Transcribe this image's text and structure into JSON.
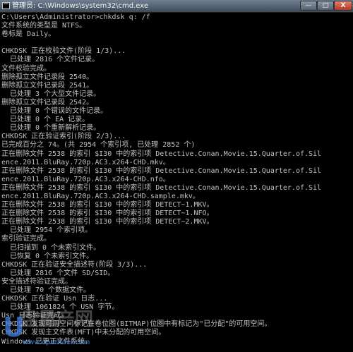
{
  "window": {
    "title": "管理员: C:\\Windows\\system32\\cmd.exe",
    "controls": {
      "minimize": "—",
      "maximize": "□",
      "close": "X"
    }
  },
  "console": {
    "lines": [
      "C:\\Users\\Administrator>chkdsk q: /f",
      "文件系统的类型是 NTFS。",
      "卷标是 Daily。",
      "",
      "CHKDSK 正在校验文件(阶段 1/3)...",
      "  已处理 2816 个文件记录。",
      "文件校验完成。",
      "删除孤立文件记录段 2540。",
      "删除孤立文件记录段 2541。",
      "  已处理 3 个大型文件记录。",
      "删除孤立文件记录段 2542。",
      "  已处理 0 个错误的文件记录。",
      "  已处理 0 个 EA 记录。",
      "  已处理 0 个重新解析记录。",
      "CHKDSK 正在验证索引(阶段 2/3)...",
      "已完成百分之 74。(共 2954 个索引项, 已处理 2852 个)",
      "正在删除文件 2538 的索引 $I30 中的索引项 Detective.Conan.Movie.15.Quarter.of.Sil",
      "ence.2011.BluRay.720p.AC3.x264-CHD.mkv。",
      "正在删除文件 2538 的索引 $I30 中的索引项 Detective.Conan.Movie.15.Quarter.of.Sil",
      "ence.2011.BluRay.720p.AC3.x264-CHD.nfo。",
      "正在删除文件 2538 的索引 $I30 中的索引项 Detective.Conan.Movie.15.Quarter.of.Sil",
      "ence.2011.BluRay.720p.AC3.x264-CHD.sample.mkv。",
      "正在删除文件 2538 的索引 $I30 中的索引项 DETECT~1.MKV。",
      "正在删除文件 2538 的索引 $I30 中的索引项 DETECT~1.NFO。",
      "正在删除文件 2538 的索引 $I30 中的索引项 DETECT~2.MKV。",
      "  已处理 2954 个索引项。",
      "索引验证完成。",
      "  已扫描到 0 个未索引文件。",
      "  已恢复 0 个未索引文件。",
      "CHKDSK 正在验证安全描述符(阶段 3/3)...",
      "  已处理 2816 个文件 SD/SID。",
      "安全描述符验证完成。",
      "  已处理 70 个数据文件。",
      "CHKDSK 正在验证 Usn 日志...",
      "  已处理 1061824 个 USN 字节。",
      "Usn 日志验证完成。",
      "CHKDSK 发现可用空间标记在卷位图(BITMAP)位图中有标记为\"已分配\"的可用空间。",
      "CHKDSK 发现主文件表(MFT)中未分配的可用空间。",
      "Windows 已更正文件系统。"
    ]
  },
  "watermark": {
    "logo": "U",
    "site": "盘量产网",
    "url": "www.upantool.com"
  },
  "colors": {
    "console_text": "#c0c0c0",
    "console_background": "#000000",
    "titlebar": "#4a586a",
    "close_button": "#c94b32",
    "watermark_blue": "#468ceb"
  }
}
